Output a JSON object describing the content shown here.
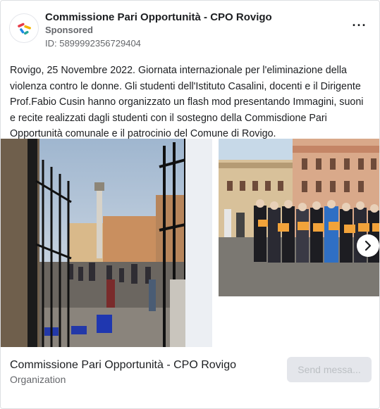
{
  "post": {
    "page_name": "Commissione Pari Opportunità - CPO Rovigo",
    "sponsored_label": "Sponsored",
    "ad_id": "ID: 5899992356729404",
    "more_icon": "more-options-icon",
    "body_text": "Rovigo, 25 Novembre 2022. Giornata internazionale per l'eliminazione della violenza contro le donne. Gli studenti dell'Istituto Casalini, docenti e il Dirigente Prof.Fabio Cusin hanno organizzato un flash mod presentando Immagini, suoni e recite realizzati dagli studenti con il sostegno della Commisdione Pari Opportunità comunale e il patrocinio del Comune di Rovigo."
  },
  "carousel": {
    "next_icon": "chevron-right-icon"
  },
  "footer": {
    "title": "Commissione Pari Opportunità - CPO Rovigo",
    "subtitle": "Organization",
    "cta_label": "Send messa..."
  },
  "colors": {
    "text_primary": "#1c1e21",
    "text_secondary": "#65676b",
    "cta_bg": "#e4e6eb",
    "cta_text": "#bcc0c4",
    "logo_red": "#e63946",
    "logo_yellow": "#f4b400",
    "logo_blue": "#1e88e5",
    "logo_teal": "#26a69a"
  }
}
